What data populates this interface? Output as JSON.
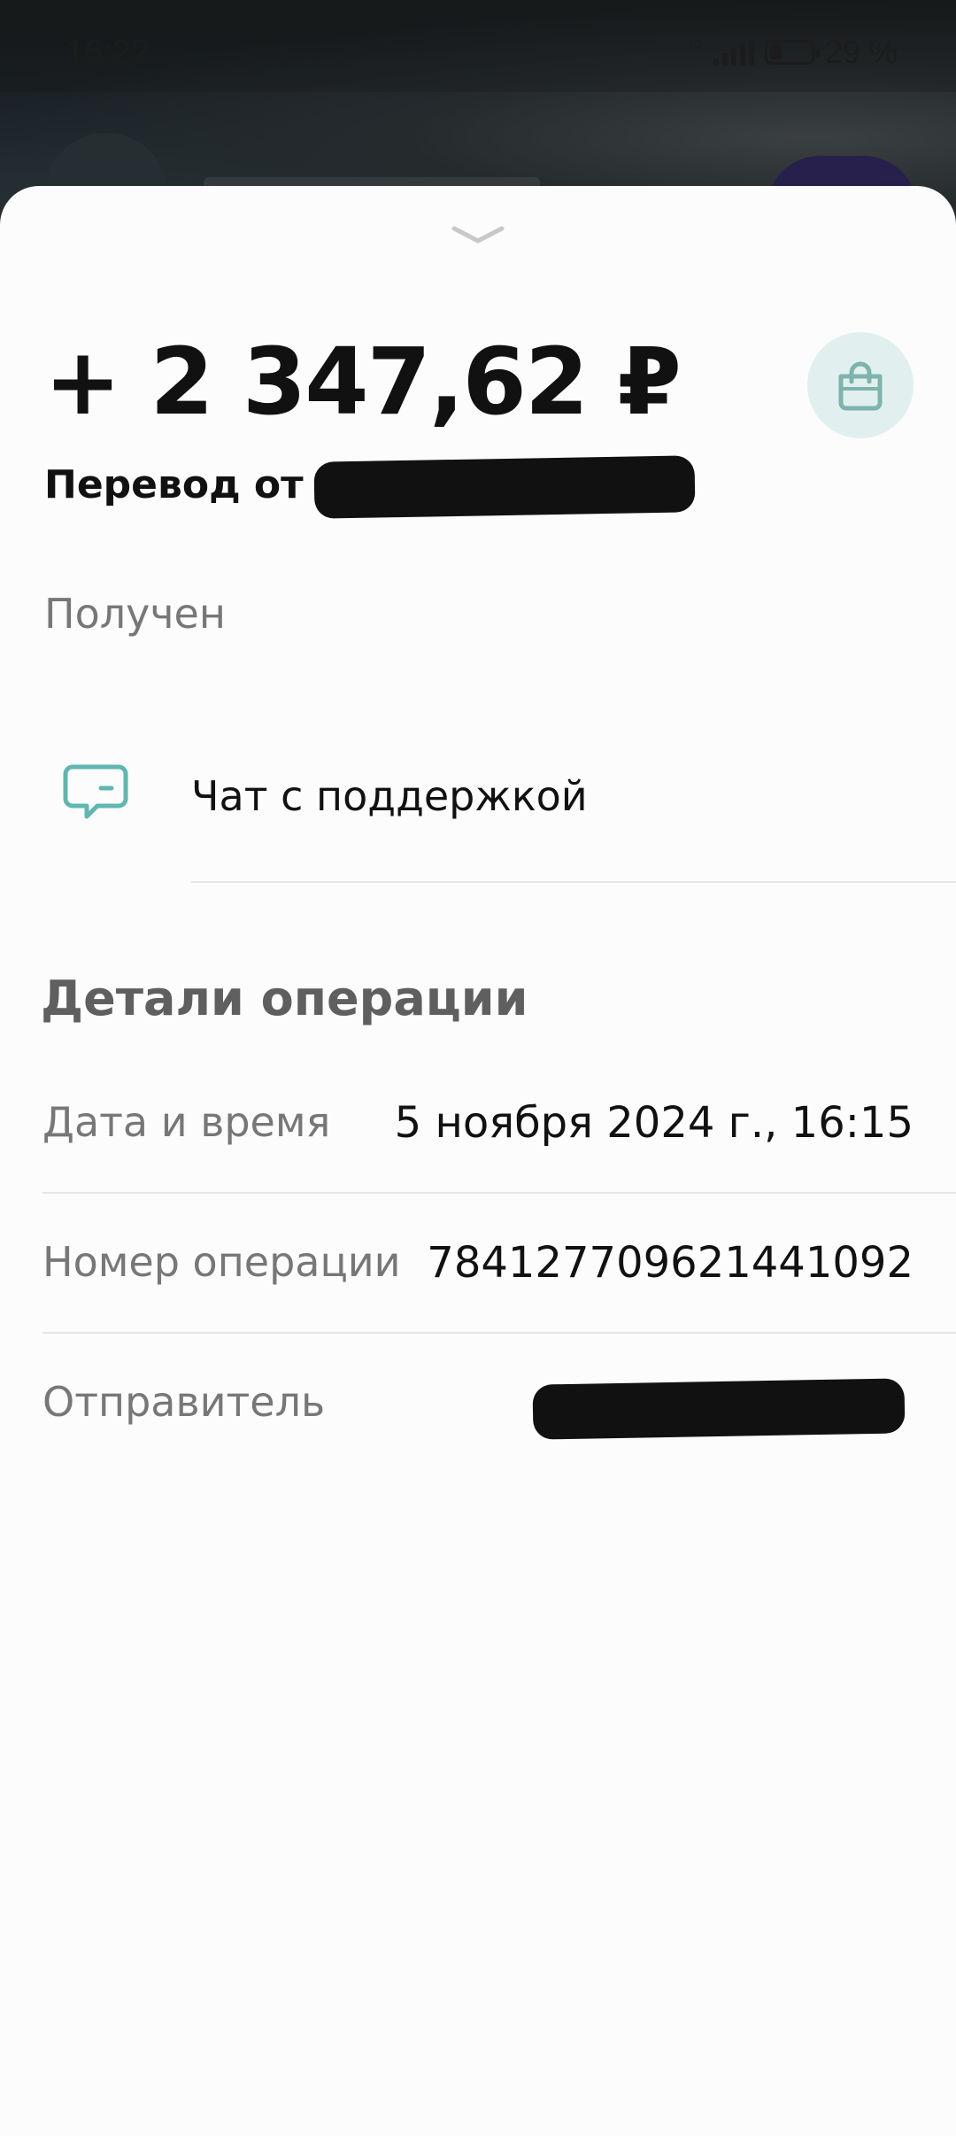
{
  "statusbar": {
    "time": "16:22",
    "network": "4G",
    "battery": "29 %"
  },
  "sheet": {
    "amount": "+ 2 347,62 ₽",
    "subtitle_prefix": "Перевод от",
    "status": "Получен",
    "support_label": "Чат с поддержкой",
    "details": {
      "title": "Детали операции",
      "rows": [
        {
          "label": "Дата и время",
          "value": "5 ноября 2024 г., 16:15"
        },
        {
          "label": "Номер операции",
          "value": "784127709621441092"
        },
        {
          "label": "Отправитель",
          "value": ""
        }
      ]
    }
  },
  "colors": {
    "accent": "#5fb7b0",
    "bag_bg": "#e1f0ee",
    "sheet_bg": "#fcfcfc"
  },
  "icons": {
    "bag": "shopping-bag-icon",
    "support": "chat-bubble-icon",
    "handle": "chevron-down-icon"
  }
}
